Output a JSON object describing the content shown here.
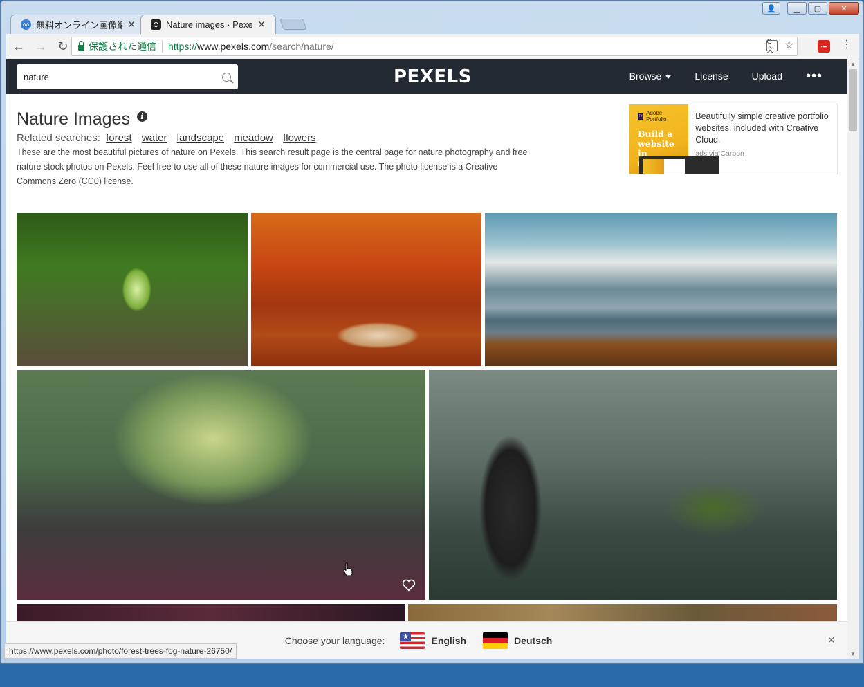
{
  "browser": {
    "tabs": [
      {
        "title": "無料オンライン画像編集",
        "favicon": "blue-circle-icon",
        "active": false
      },
      {
        "title": "Nature images · Pexels",
        "favicon": "camera-icon",
        "active": true
      }
    ],
    "address": {
      "secure_label": "保護された通信",
      "scheme": "https://",
      "host": "www.pexels.com",
      "path": "/search/nature/"
    },
    "status_url": "https://www.pexels.com/photo/forest-trees-fog-nature-26750/"
  },
  "site": {
    "search_value": "nature",
    "logo": "PEXELS",
    "nav": {
      "browse": "Browse",
      "license": "License",
      "upload": "Upload",
      "more": "•••"
    }
  },
  "intro": {
    "title": "Nature Images",
    "related_label": "Related searches:",
    "related": [
      "forest",
      "water",
      "landscape",
      "meadow",
      "flowers"
    ],
    "description": "These are the most beautiful pictures of nature on Pexels. This search result page is the central page for nature photography and free nature stock photos on Pexels. Feel free to use all of these nature images for commercial use. The photo license is a Creative Commons Zero (CC0) license."
  },
  "ad": {
    "brand": "Adobe Portfolio",
    "headline_line1": "Build a website",
    "headline_line2": "in minutes.",
    "text": "Beautifully simple creative portfolio websites, included with Creative Cloud.",
    "via": "ads via Carbon"
  },
  "photos": [
    {
      "name": "railway-forest-photo"
    },
    {
      "name": "autumn-path-photo"
    },
    {
      "name": "mountain-lake-photo"
    },
    {
      "name": "foggy-forest-photo"
    },
    {
      "name": "stacked-stones-photo"
    },
    {
      "name": "dark-forest-photo"
    },
    {
      "name": "autumn-trees-photo"
    }
  ],
  "language_bar": {
    "label": "Choose your language:",
    "options": [
      "English",
      "Deutsch"
    ],
    "close": "×"
  }
}
